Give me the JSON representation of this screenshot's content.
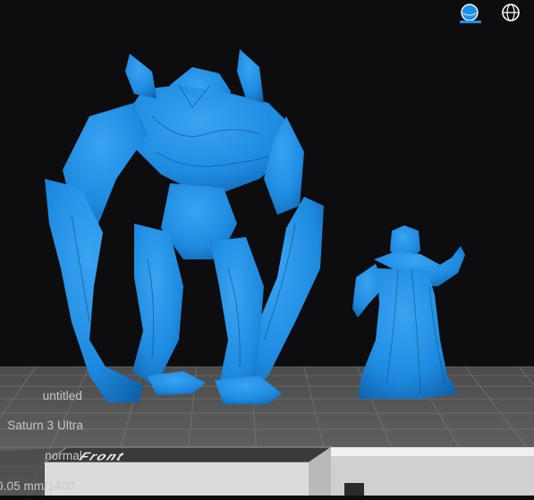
{
  "toolbar": {
    "buttons": [
      {
        "name": "solid-view",
        "icon": "solid-sphere-icon",
        "active": true
      },
      {
        "name": "wireframe-view",
        "icon": "wireframe-sphere-icon",
        "active": false
      }
    ],
    "active_color": "#1e8fe8"
  },
  "scene": {
    "model_color": "#1f8be0",
    "plate_color": "#5d5d5d",
    "background_color": "#0d0d10",
    "models": [
      {
        "name": "giant-monster-model"
      },
      {
        "name": "robed-skeleton-model"
      }
    ]
  },
  "view_cube": {
    "face_label": "Front"
  },
  "info": {
    "file_name": "untitled",
    "printer": "Saturn 3 Ultra",
    "profile": "normal",
    "layer": "0.05 mm/1400"
  }
}
